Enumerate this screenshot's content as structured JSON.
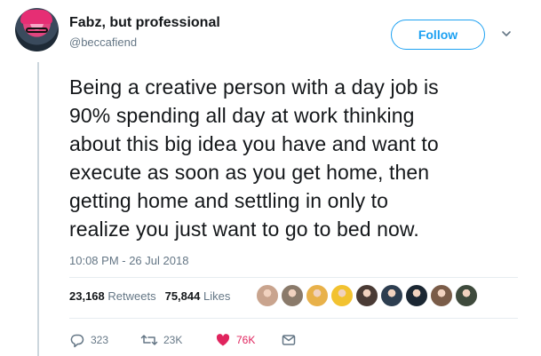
{
  "user": {
    "display_name": "Fabz, but professional",
    "handle": "@beccafiend"
  },
  "follow_label": "Follow",
  "tweet": {
    "text": "Being a creative person with a day job is\n90% spending all day at work thinking\nabout this big idea you have and want to\nexecute as soon as you get home, then\ngetting home and settling in only to\nrealize you just want to go to bed now.",
    "timestamp": "10:08 PM - 26 Jul 2018"
  },
  "stats": {
    "retweets_count": "23,168",
    "retweets_label": "Retweets",
    "likes_count": "75,844",
    "likes_label": "Likes"
  },
  "liker_colors": [
    "#c9a48e",
    "#8a7a6a",
    "#e8b14a",
    "#f2c230",
    "#4a3b35",
    "#2d3e50",
    "#1b2733",
    "#7a5c48",
    "#3e4a3c"
  ],
  "actions": {
    "reply_count": "323",
    "retweet_count": "23K",
    "like_count": "76K"
  },
  "colors": {
    "accent": "#1da1f2",
    "like": "#e0245e",
    "muted": "#657786"
  }
}
